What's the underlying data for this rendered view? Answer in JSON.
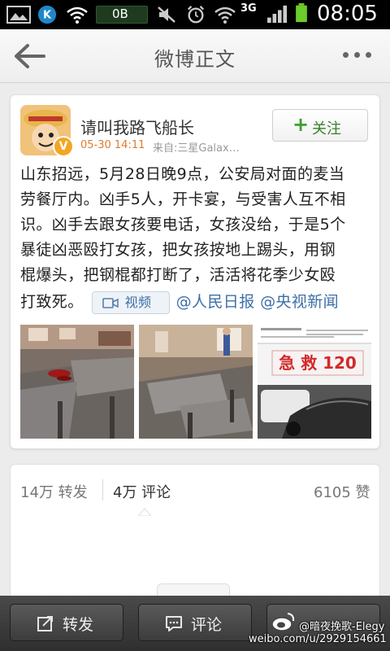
{
  "status_bar": {
    "net_speed": "0B",
    "network_type": "3G",
    "time": "08:05"
  },
  "header": {
    "title": "微博正文"
  },
  "post": {
    "username": "请叫我路飞船长",
    "time": "05-30 14:11",
    "source": "来自:三星Galax…",
    "follow_label": "关注",
    "text_lines": [
      "山东招远，5月28日晚9点，公安局对面的麦当",
      "劳餐厅内。凶手5人，开卡宴，与受害人互不相",
      "识。凶手去跟女孩要电话，女孩没给，于是5个",
      "暴徒凶恶殴打女孩，把女孩按地上踢头，用钢",
      "棍爆头，把钢棍都打断了，活活将花季少女殴"
    ],
    "text_last": "打致死。",
    "video_label": "视频",
    "mentions": [
      "@人民日报",
      "@央视新闻"
    ],
    "thumb3_sign": "急 救 120"
  },
  "stats": {
    "repost": "14万 转发",
    "comment": "4万 评论",
    "like": "6105 赞"
  },
  "toolbar": {
    "repost": "转发",
    "comment": "评论"
  },
  "watermark": {
    "handle": "@暗夜挽歌-Elegy",
    "url": "weibo.com/u/2929154661"
  },
  "colors": {
    "accent_orange": "#e07a2e",
    "link_blue": "#3d6fa8",
    "follow_green": "#3aa12b",
    "battery_green": "#6ccc2c"
  }
}
